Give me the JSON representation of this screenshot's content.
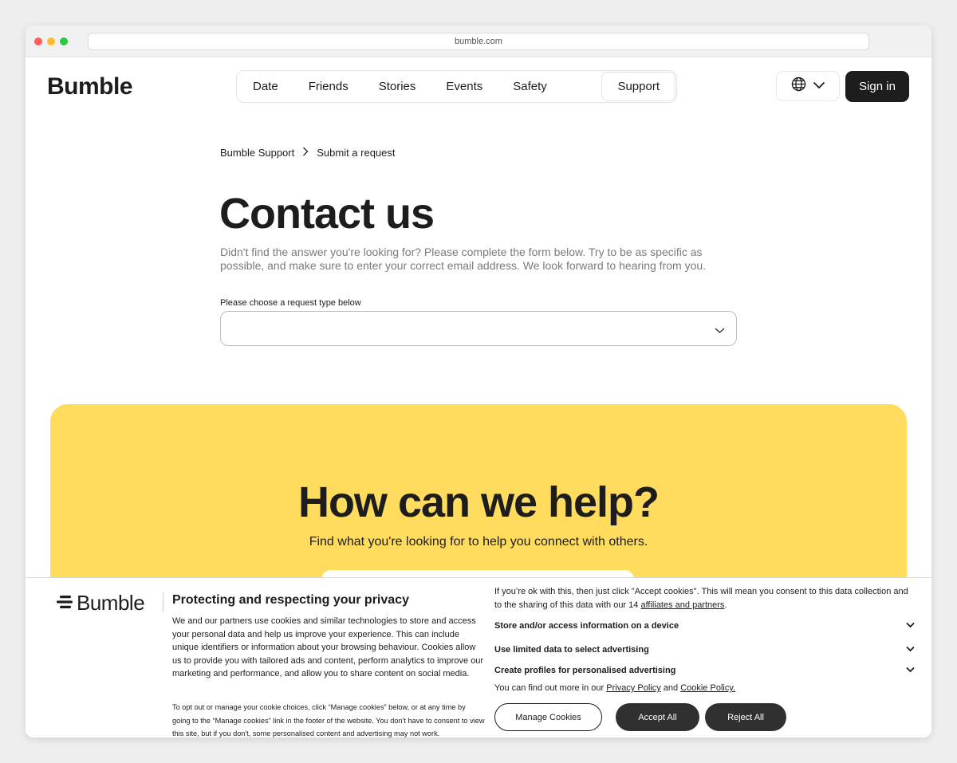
{
  "browser": {
    "url": "bumble.com"
  },
  "header": {
    "logo": "Bumble",
    "nav": [
      {
        "label": "Date"
      },
      {
        "label": "Friends"
      },
      {
        "label": "Stories"
      },
      {
        "label": "Events"
      },
      {
        "label": "Safety"
      },
      {
        "label": "Support"
      }
    ],
    "active_nav": "Support",
    "language_icon": "globe-icon",
    "sign_in": "Sign in"
  },
  "breadcrumb": {
    "items": [
      "Bumble Support",
      "Submit a request"
    ]
  },
  "contact": {
    "title": "Contact us",
    "intro": "Didn't find the answer you're looking for? Please complete the form below. Try to be as specific as possible, and make sure to enter your correct email address. We look forward to hearing from you.",
    "select_label": "Please choose a request type below",
    "select_value": ""
  },
  "help": {
    "title": "How can we help?",
    "subtitle": "Find what you're looking for to help you connect with others."
  },
  "cookie": {
    "logo": "Bumble",
    "title": "Protecting and respecting your privacy",
    "body": "We and our partners use cookies and similar technologies to store and access your personal data and help us improve your experience. This can include unique identifiers or information about your browsing behaviour. Cookies allow us to provide you with tailored ads and content, perform analytics to improve our marketing and performance, and allow you to share content on social media.",
    "small": "To opt out or manage your cookie choices, click “Manage cookies” below, or at any time by going to the “Manage cookies” link in the footer of the website. You don't have to consent to view this site, but if you don't, some personalised content and advertising may not work.",
    "right_intro": "If you’re ok with this, then just click \"Accept cookies\". This will mean you consent to this data collection and to the sharing of this data with our 14 ",
    "affiliates_link": "affiliates and partners",
    "right_intro_end": ".",
    "purposes": [
      "Store and/or access information on a device",
      "Use limited data to select advertising",
      "Create profiles for personalised advertising"
    ],
    "find_out_prefix": "You can find out more in our ",
    "privacy_link": "Privacy Policy",
    "and_text": " and ",
    "cookie_link": "Cookie Policy.",
    "manage_btn": "Manage Cookies",
    "accept_btn": "Accept All",
    "reject_btn": "Reject All"
  }
}
